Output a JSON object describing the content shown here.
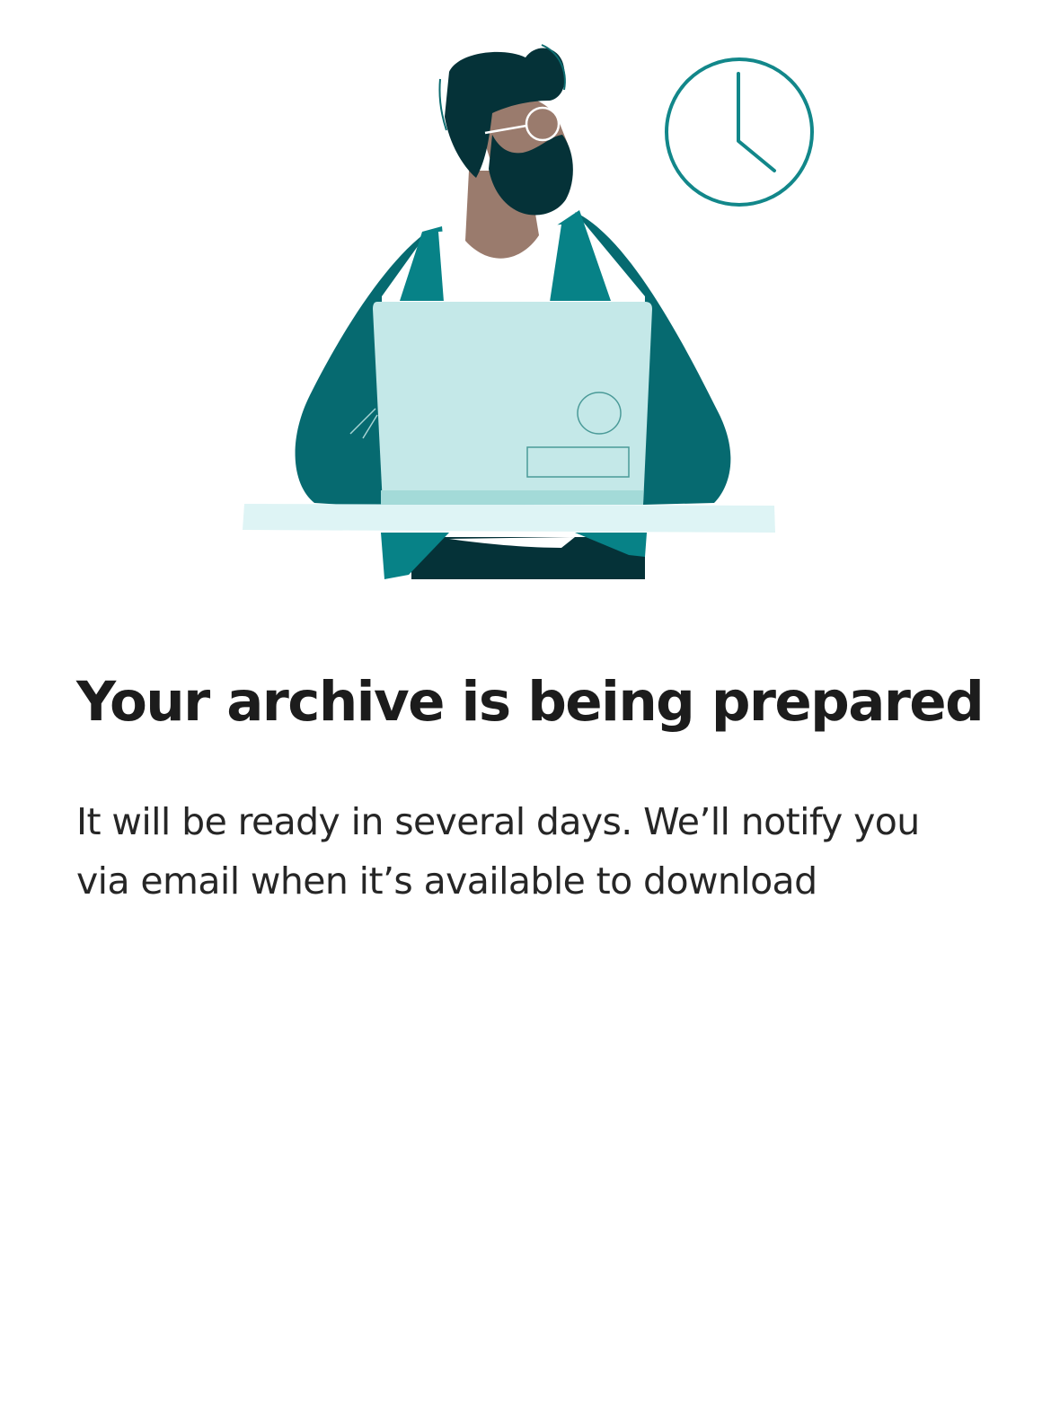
{
  "screen": {
    "illustration": {
      "name": "person-working-on-laptop-illustration",
      "clock_icon": "clock-icon"
    },
    "title": "Your archive is being prepared",
    "message": "It will be ready in several days. We’ll notify you via email when it’s available to download"
  },
  "colors": {
    "background": "#ffffff",
    "title_text": "#1c1c1c",
    "body_text": "#262626",
    "teal_dark": "#066a70",
    "teal": "#078287",
    "teal_deep": "#053238",
    "laptop": "#c4e8e8",
    "desk": "#def4f5",
    "skin": "#9a7b6d"
  }
}
